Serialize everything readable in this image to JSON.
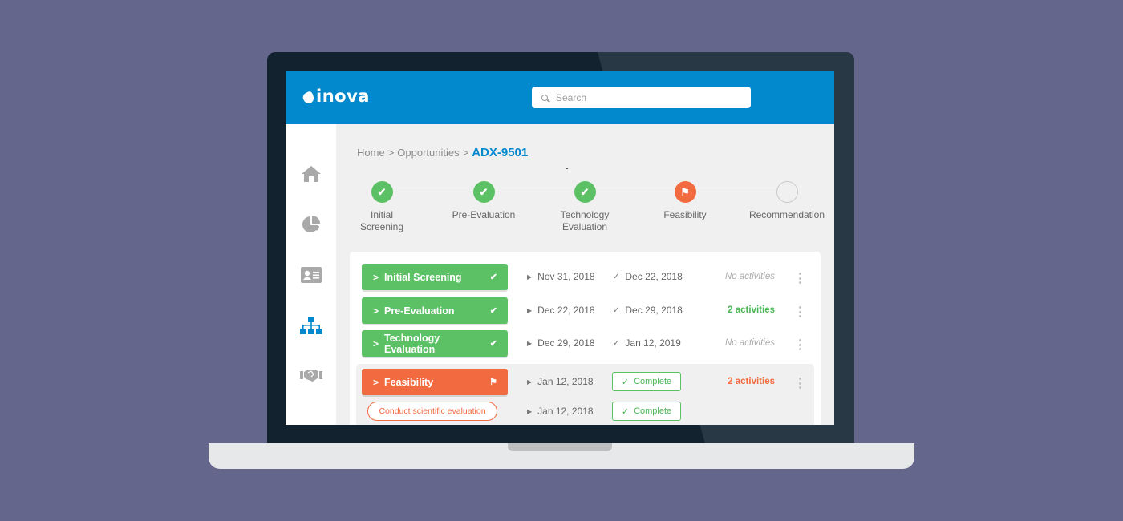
{
  "app": {
    "logo_text": "inova",
    "search": {
      "placeholder": "Search",
      "value": ""
    }
  },
  "sidebar": {
    "items": [
      {
        "name": "home",
        "icon": "home-icon",
        "glyph": "⌂",
        "active": false
      },
      {
        "name": "reports",
        "icon": "pie-chart-icon",
        "glyph": "◕",
        "active": false
      },
      {
        "name": "contacts",
        "icon": "id-card-icon",
        "glyph": "▤",
        "active": false
      },
      {
        "name": "hierarchy",
        "icon": "org-chart-icon",
        "glyph": "⊥",
        "active": true
      },
      {
        "name": "partners",
        "icon": "handshake-icon",
        "glyph": "✋",
        "active": false
      }
    ]
  },
  "breadcrumb": {
    "items": [
      "Home",
      "Opportunities"
    ],
    "separator": ">",
    "current": "ADX-9501"
  },
  "stepper": {
    "steps": [
      {
        "label_line1": "Initial",
        "label_line2": "Screening",
        "status": "done"
      },
      {
        "label_line1": "Pre-Evaluation",
        "label_line2": "",
        "status": "done"
      },
      {
        "label_line1": "Technology",
        "label_line2": "Evaluation",
        "status": "done"
      },
      {
        "label_line1": "Feasibility",
        "label_line2": "",
        "status": "flagged"
      },
      {
        "label_line1": "Recommendation",
        "label_line2": "",
        "status": "pending"
      }
    ]
  },
  "stages": [
    {
      "label": "Initial Screening",
      "status": "done",
      "start": "Nov 31, 2018",
      "end": "Dec 22, 2018",
      "activities": "No activities",
      "activities_type": "none"
    },
    {
      "label": "Pre-Evaluation",
      "status": "done",
      "start": "Dec 22, 2018",
      "end": "Dec 29, 2018",
      "activities": "2 activities",
      "activities_type": "green"
    },
    {
      "label": "Technology Evaluation",
      "status": "done",
      "start": "Dec 29, 2018",
      "end": "Jan 12, 2019",
      "activities": "No activities",
      "activities_type": "none"
    },
    {
      "label": "Feasibility",
      "status": "flagged",
      "start": "Jan 12, 2018",
      "end_badge": "Complete",
      "activities": "2 activities",
      "activities_type": "orange"
    }
  ],
  "subtasks": [
    {
      "label": "Conduct scientific evaluation",
      "start": "Jan 12, 2018",
      "badge": "Complete"
    }
  ],
  "glyphs": {
    "chevron": ">",
    "check": "✔",
    "flag": "⚑",
    "play": "▶",
    "small_check": "✓"
  },
  "colors": {
    "brand_blue": "#0288cc",
    "success_green": "#5cc065",
    "flag_orange": "#f26a3f",
    "background": "#64668c"
  }
}
